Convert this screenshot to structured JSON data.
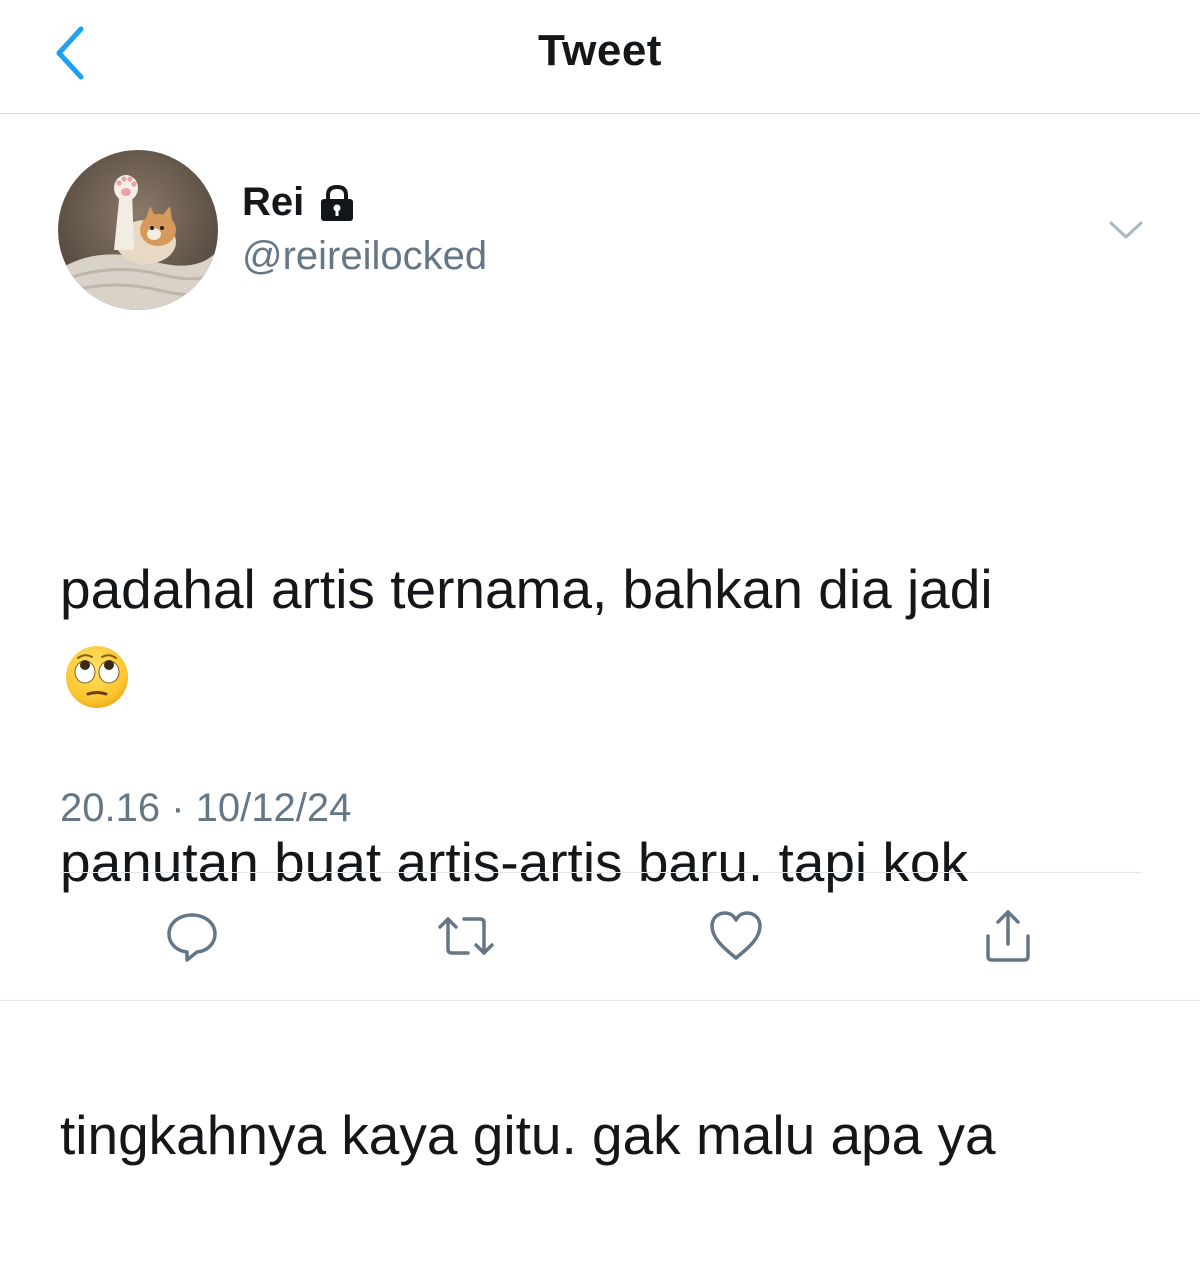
{
  "header": {
    "title": "Tweet",
    "back_icon": "chevron-left-icon"
  },
  "author": {
    "name": "Rei",
    "handle": "@reireilocked",
    "protected_icon": "lock-icon",
    "avatar_icon": "cat-avatar"
  },
  "tweet": {
    "lines": [
      "padahal artis ternama, bahkan dia jadi",
      "panutan buat artis-artis baru. tapi kok",
      "tingkahnya kaya gitu. gak malu apa ya"
    ],
    "emoji": "face-with-rolling-eyes",
    "time": "20.16",
    "separator": " · ",
    "date": "10/12/24"
  },
  "actions": [
    {
      "name": "reply",
      "icon": "reply-icon"
    },
    {
      "name": "retweet",
      "icon": "retweet-icon"
    },
    {
      "name": "like",
      "icon": "heart-icon"
    },
    {
      "name": "share",
      "icon": "share-icon"
    }
  ],
  "colors": {
    "accent": "#1da1f2",
    "secondary_text": "#657786",
    "icon_gray": "#657786",
    "text": "#14171a"
  }
}
